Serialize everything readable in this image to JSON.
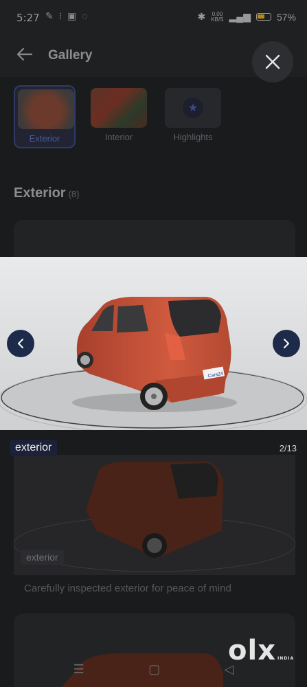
{
  "status_bar": {
    "time": "5:27",
    "speed_value": "0.00",
    "speed_unit": "KB/S",
    "battery": "57%"
  },
  "header": {
    "title": "Gallery"
  },
  "tabs": [
    {
      "label": "Exterior"
    },
    {
      "label": "Interior"
    },
    {
      "label": "Highlights"
    }
  ],
  "section": {
    "title": "Exterior",
    "count": "(8)"
  },
  "viewer": {
    "label": "exterior",
    "counter": "2/13"
  },
  "background_card": {
    "label": "exterior",
    "caption": "Carefully inspected exterior for peace of mind"
  },
  "watermark": {
    "brand": "olx",
    "sub": "INDIA"
  },
  "colors": {
    "accent": "#1e2a4a",
    "car_body": "#c9553a"
  }
}
